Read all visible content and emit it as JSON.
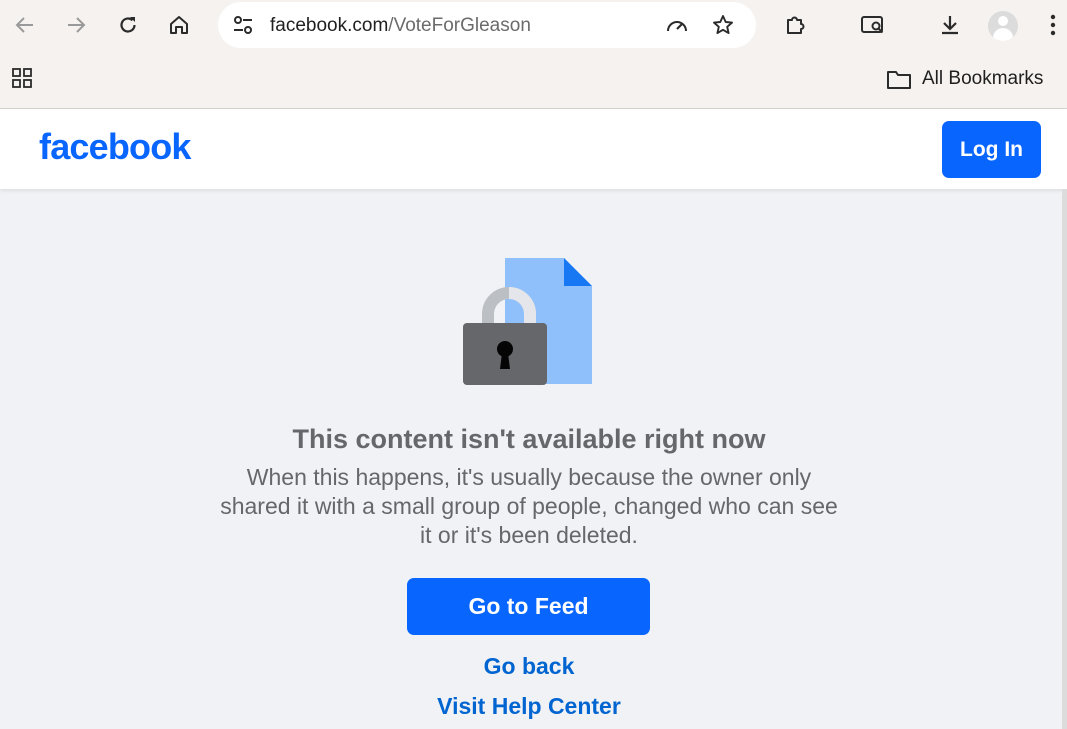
{
  "browser": {
    "url_domain": "facebook.com",
    "url_path": "/VoteForGleason",
    "bookmarks_label": "All Bookmarks",
    "icons": {
      "back": "arrow-left-icon",
      "forward": "arrow-right-icon",
      "reload": "reload-icon",
      "home": "home-icon",
      "site_info": "tune-icon",
      "performance": "gauge-icon",
      "bookmark_star": "star-icon",
      "extensions": "puzzle-icon",
      "search_tab": "tab-search-icon",
      "downloads": "download-icon",
      "profile": "profile-avatar-icon",
      "menu": "kebab-menu-icon",
      "apps": "apps-grid-icon",
      "bookmarks_folder": "folder-icon"
    }
  },
  "header": {
    "logo_text": "facebook",
    "login_label": "Log In"
  },
  "content": {
    "title": "This content isn't available right now",
    "message": "When this happens, it's usually because the owner only shared it with a small group of people, changed who can see it or it's been deleted.",
    "primary_button": "Go to Feed",
    "go_back_link": "Go back",
    "help_link": "Visit Help Center",
    "illustration": "locked-document-icon"
  },
  "colors": {
    "brand_blue": "#0866ff",
    "link_blue": "#0064d1",
    "text_gray": "#65676b",
    "page_bg": "#f0f2f5",
    "doc_blue": "#8fc0fc",
    "lock_dark": "#65676b"
  }
}
